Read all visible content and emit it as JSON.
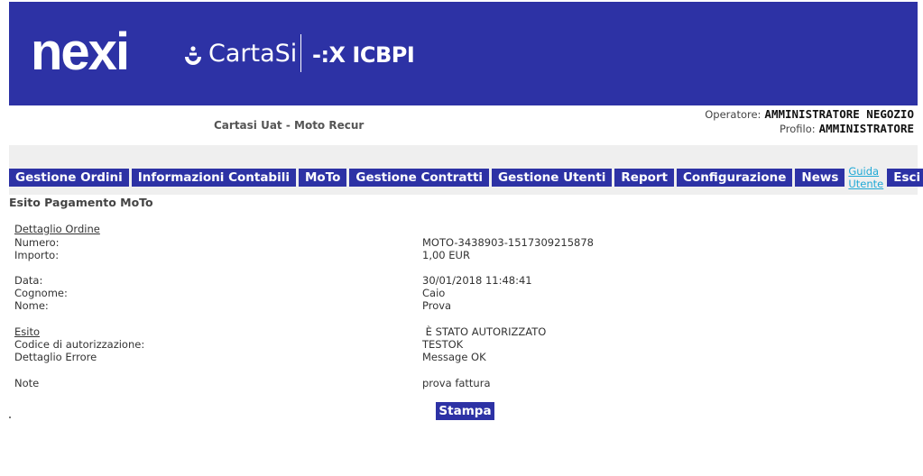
{
  "header": {
    "logo_nexi": "nexi",
    "logo_cartasi": "CartaSi",
    "logo_icbpi": "ICBPI",
    "brand_color": "#2d32a5",
    "site_name": "Cartasi Uat - Moto Recur"
  },
  "user": {
    "operator_label": "Operatore:",
    "operator_value": "AMMINISTRATORE NEGOZIO",
    "profile_label": "Profilo:",
    "profile_value": "AMMINISTRATORE"
  },
  "nav": {
    "items": [
      {
        "label": "Gestione Ordini"
      },
      {
        "label": "Informazioni Contabili"
      },
      {
        "label": "MoTo"
      },
      {
        "label": "Gestione Contratti"
      },
      {
        "label": "Gestione Utenti"
      },
      {
        "label": "Report"
      },
      {
        "label": "Configurazione"
      },
      {
        "label": "News"
      }
    ],
    "guide_link": "Guida Utente",
    "exit_label": "Esci",
    "link_color": "#1fa9d6"
  },
  "page": {
    "title": "Esito Pagamento MoTo",
    "order_section": "Dettaglio Ordine",
    "fields": {
      "numero_label": "Numero:",
      "numero_value": "MOTO-3438903-1517309215878",
      "importo_label": "Importo:",
      "importo_value": "1,00 EUR",
      "data_label": "Data:",
      "data_value": "30/01/2018 11:48:41",
      "cognome_label": "Cognome:",
      "cognome_value": "Caio",
      "nome_label": "Nome:",
      "nome_value": "Prova",
      "esito_label": "Esito",
      "esito_value": " È STATO AUTORIZZATO",
      "codice_label": "Codice di autorizzazione:",
      "codice_value": "TESTOK",
      "errore_label": "Dettaglio Errore",
      "errore_value": "Message OK",
      "note_label": "Note",
      "note_value": "prova fattura"
    },
    "print_button": "Stampa"
  }
}
